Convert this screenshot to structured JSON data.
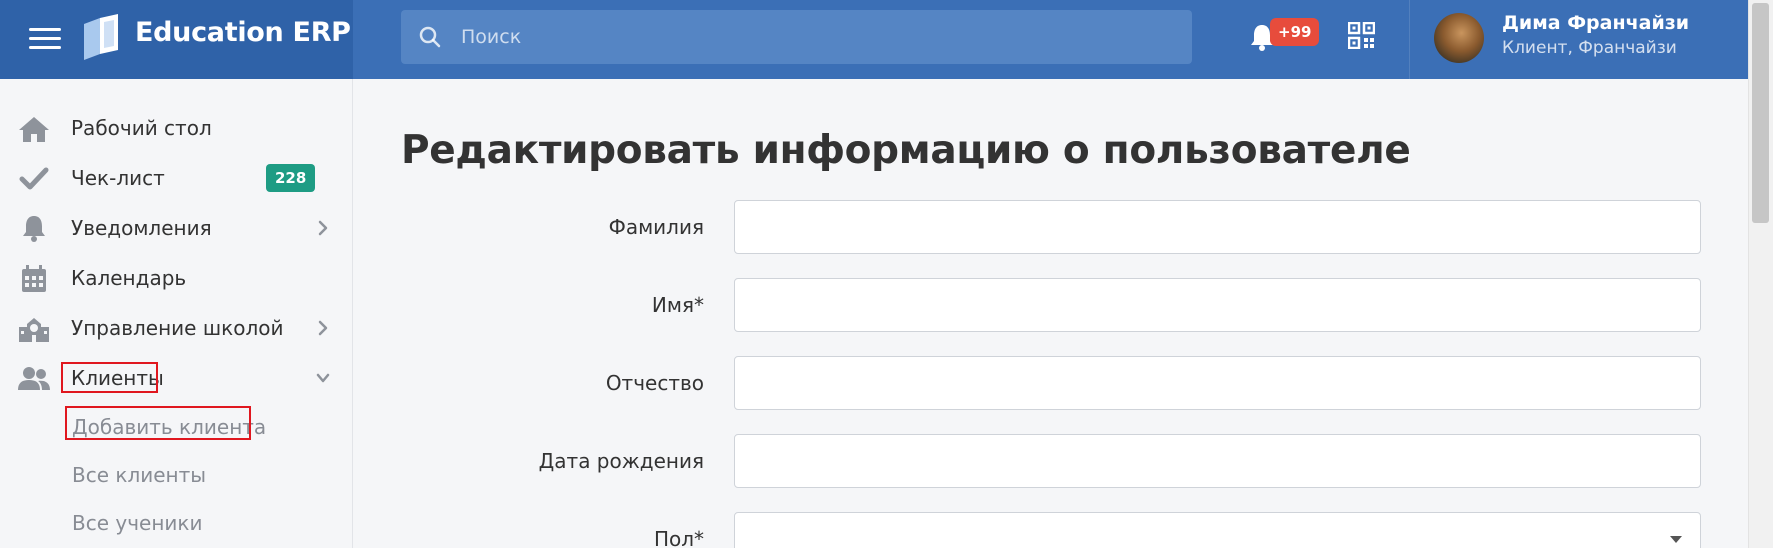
{
  "header": {
    "brand": "Education ERP",
    "search_placeholder": "Поиск",
    "notifications_badge": "+99",
    "user": {
      "name": "Дима Франчайзи",
      "role": "Клиент, Франчайзи"
    }
  },
  "sidebar": {
    "items": [
      {
        "label": "Рабочий стол",
        "icon": "home-icon"
      },
      {
        "label": "Чек-лист",
        "icon": "check-icon",
        "badge": "228"
      },
      {
        "label": "Уведомления",
        "icon": "bell-icon",
        "chevron": "right"
      },
      {
        "label": "Календарь",
        "icon": "calendar-icon"
      },
      {
        "label": "Управление школой",
        "icon": "school-icon",
        "chevron": "right"
      },
      {
        "label": "Клиенты",
        "icon": "users-icon",
        "chevron": "down",
        "highlighted": true
      }
    ],
    "subitems": [
      {
        "label": "Добавить клиента",
        "highlighted": true
      },
      {
        "label": "Все клиенты"
      },
      {
        "label": "Все ученики"
      }
    ]
  },
  "main": {
    "title": "Редактировать информацию о пользователе",
    "fields": [
      {
        "label": "Фамилия",
        "value": ""
      },
      {
        "label": "Имя*",
        "value": ""
      },
      {
        "label": "Отчество",
        "value": ""
      },
      {
        "label": "Дата рождения",
        "value": ""
      },
      {
        "label": "Пол*",
        "value": ""
      }
    ]
  },
  "colors": {
    "header": "#3b6fb6",
    "brand_area": "#2f62a8",
    "badge_red": "#e74c3c",
    "badge_green": "#1e9c84",
    "highlight_box": "#e0171f"
  }
}
